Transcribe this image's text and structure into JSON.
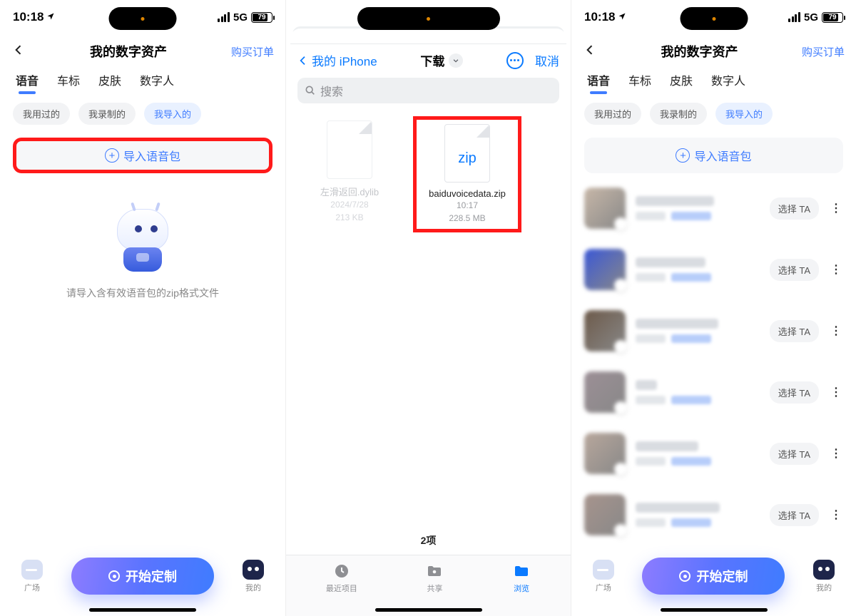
{
  "status": {
    "time": "10:18",
    "net": "5G",
    "battery_pct": 79
  },
  "asset_header": {
    "title": "我的数字资产",
    "order_link": "购买订单"
  },
  "tabs": [
    "语音",
    "车标",
    "皮肤",
    "数字人"
  ],
  "chips": [
    "我用过的",
    "我录制的",
    "我导入的"
  ],
  "import_label": "导入语音包",
  "empty_hint": "请导入含有效语音包的zip格式文件",
  "bottom": {
    "plaza": "广场",
    "cta": "开始定制",
    "mine": "我的"
  },
  "files": {
    "back": "我的 iPhone",
    "title": "下载",
    "cancel": "取消",
    "search_placeholder": "搜索",
    "count_label": "2项",
    "item_dim": {
      "name": "左滑返回.dylib",
      "date": "2024/7/28",
      "size": "213 KB"
    },
    "item_zip": {
      "badge": "zip",
      "name": "baiduvoicedata.zip",
      "time": "10:17",
      "size": "228.5 MB"
    },
    "tabs": {
      "recent": "最近项目",
      "shared": "共享",
      "browse": "浏览"
    }
  },
  "list": {
    "select_label": "选择 TA",
    "thumbs": [
      "#c7b7a8",
      "#3b58d6",
      "#6d5a4a",
      "#9c8f96",
      "#b8a79c",
      "#a7948d"
    ],
    "title_widths": [
      110,
      98,
      116,
      30,
      88,
      118
    ]
  }
}
